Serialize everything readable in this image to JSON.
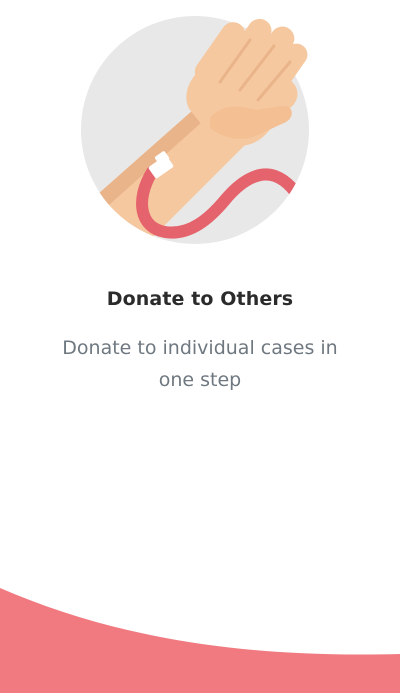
{
  "onboarding": {
    "illustration_icon": "donate-blood-arm-icon",
    "title": "Donate to Others",
    "subtitle": "Donate to individual cases in one step"
  },
  "colors": {
    "circle_background": "#e8e8e8",
    "skin": "#f6c8a0",
    "skin_shadow": "#eab48a",
    "tube": "#e5636c",
    "tape": "#ffffff",
    "title_text": "#2b2b2b",
    "subtitle_text": "#6f7880",
    "wave": "#f07a80"
  }
}
